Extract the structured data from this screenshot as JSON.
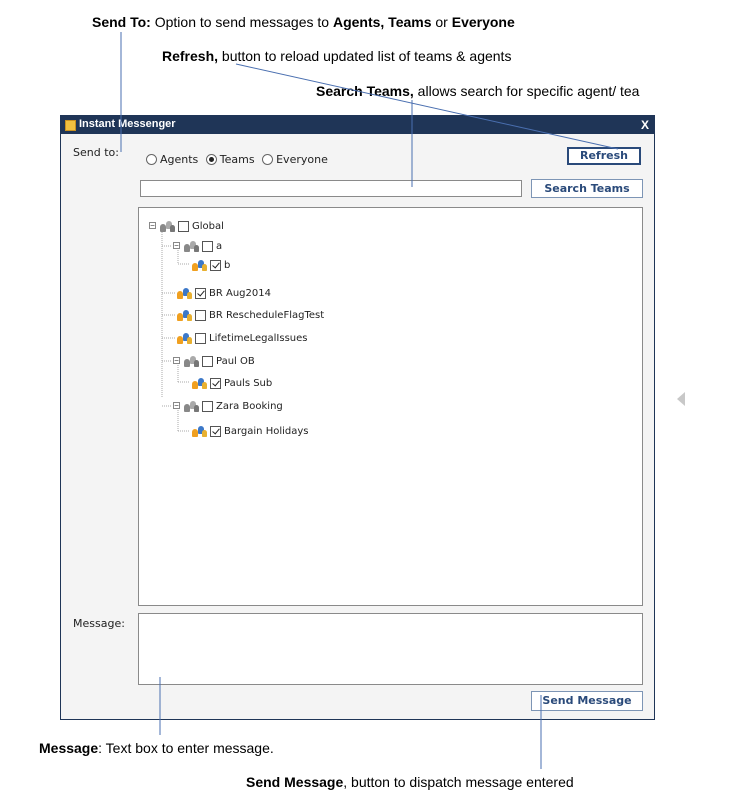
{
  "annotations": {
    "send_to": {
      "term": "Send To:",
      "text": " Option to send messages to ",
      "b1": "Agents, Teams",
      "mid": " or ",
      "b2": "Everyone"
    },
    "refresh": {
      "term": "Refresh,",
      "text": " button to reload updated list of teams & agents"
    },
    "search": {
      "term": "Search Teams,",
      "text": " allows search for specific agent/ tea"
    },
    "message": {
      "term": "Message",
      "text": ": Text box to enter message."
    },
    "send_message": {
      "term": "Send Message",
      "text": ", button to dispatch message entered"
    }
  },
  "window": {
    "title": "Instant Messenger",
    "close": "X",
    "send_to_label": "Send to:",
    "message_label": "Message:",
    "radios": [
      {
        "label": "Agents",
        "selected": false
      },
      {
        "label": "Teams",
        "selected": true
      },
      {
        "label": "Everyone",
        "selected": false
      }
    ],
    "refresh_label": "Refresh",
    "search_button_label": "Search Teams",
    "search_value": "",
    "send_button_label": "Send Message",
    "message_value": "",
    "tree": [
      {
        "label": "Global",
        "checked": false,
        "expander": "minus"
      },
      {
        "label": "a",
        "checked": false,
        "expander": "minus"
      },
      {
        "label": "b",
        "checked": true,
        "expander": null
      },
      {
        "label": "BR Aug2014",
        "checked": true,
        "expander": null
      },
      {
        "label": "BR RescheduleFlagTest",
        "checked": false,
        "expander": null
      },
      {
        "label": "LifetimeLegalIssues",
        "checked": false,
        "expander": null
      },
      {
        "label": "Paul OB",
        "checked": false,
        "expander": "minus"
      },
      {
        "label": "Pauls Sub",
        "checked": true,
        "expander": null
      },
      {
        "label": "Zara Booking",
        "checked": false,
        "expander": "minus"
      },
      {
        "label": "Bargain Holidays",
        "checked": true,
        "expander": null
      }
    ]
  },
  "colors": {
    "titlebar": "#1f3557",
    "button_text": "#2a4a7a",
    "leader_line": "#4a6fb0"
  }
}
